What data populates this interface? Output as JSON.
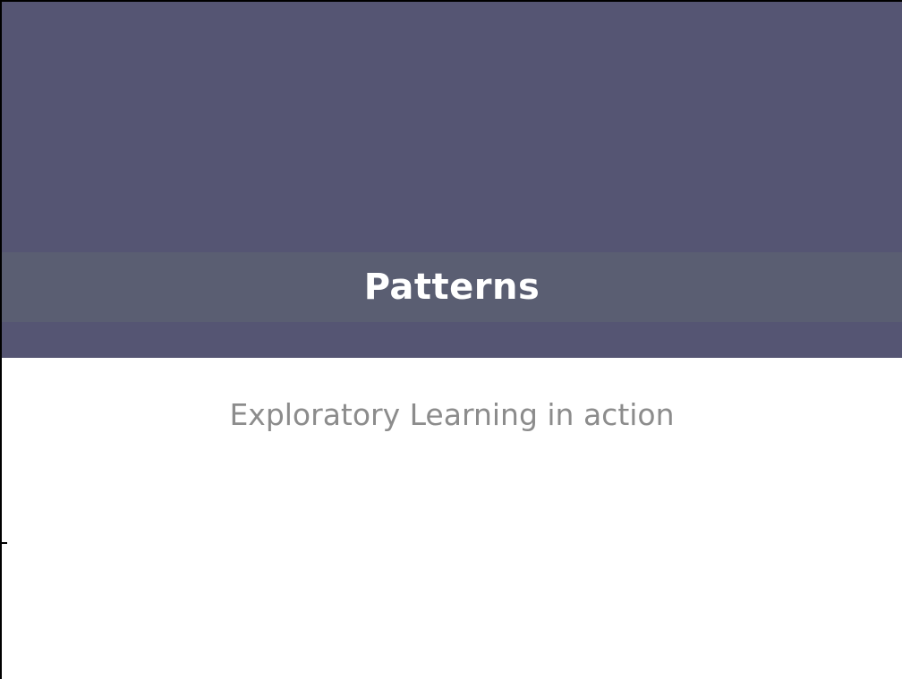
{
  "slide": {
    "title": "Patterns",
    "subtitle": "Exploratory Learning in action"
  },
  "colors": {
    "header_band": "#555573",
    "title_strip": "#5a5e72",
    "title_text": "#ffffff",
    "subtitle_text": "#8c8c8c"
  }
}
